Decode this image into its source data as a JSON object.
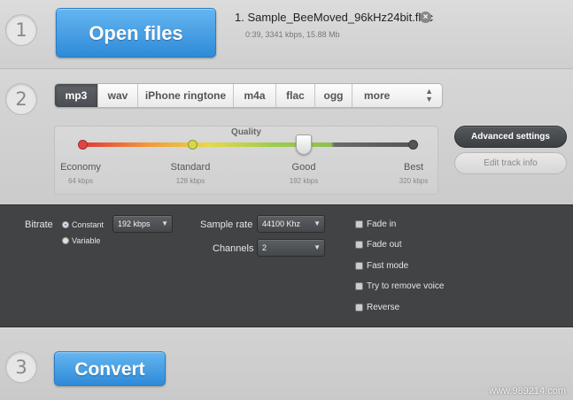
{
  "step1": {
    "number": "1",
    "open_label": "Open files",
    "file_name": "1. Sample_BeeMoved_96kHz24bit.flac",
    "file_meta": "0:39, 3341 kbps, 15.88 Mb",
    "remove_icon": "close-circle-icon"
  },
  "step2": {
    "number": "2",
    "tabs": [
      {
        "label": "mp3",
        "active": true
      },
      {
        "label": "wav",
        "active": false
      },
      {
        "label": "iPhone ringtone",
        "active": false
      },
      {
        "label": "m4a",
        "active": false
      },
      {
        "label": "flac",
        "active": false
      },
      {
        "label": "ogg",
        "active": false
      },
      {
        "label": "more",
        "active": false
      }
    ],
    "quality": {
      "title": "Quality",
      "levels": [
        {
          "name": "Economy",
          "kbps": "64 kbps",
          "color": "#e24444"
        },
        {
          "name": "Standard",
          "kbps": "128 kbps",
          "color": "#d4d84a"
        },
        {
          "name": "Good",
          "kbps": "192 kbps",
          "color": "#9ccc4e"
        },
        {
          "name": "Best",
          "kbps": "320 kbps",
          "color": "#555555"
        }
      ],
      "selected": "Good"
    },
    "advanced_settings_label": "Advanced settings",
    "edit_track_label": "Edit track info"
  },
  "advanced": {
    "bitrate_label": "Bitrate",
    "constant_label": "Constant",
    "variable_label": "Variable",
    "bitrate_mode": "Constant",
    "bitrate_value": "192 kbps",
    "sample_rate_label": "Sample rate",
    "sample_rate_value": "44100 Khz",
    "channels_label": "Channels",
    "channels_value": "2",
    "options": [
      {
        "label": "Fade in",
        "checked": false
      },
      {
        "label": "Fade out",
        "checked": false
      },
      {
        "label": "Fast mode",
        "checked": false
      },
      {
        "label": "Try to remove voice",
        "checked": false
      },
      {
        "label": "Reverse",
        "checked": false
      }
    ]
  },
  "step3": {
    "number": "3",
    "convert_label": "Convert"
  },
  "watermark": "www.989214.com",
  "colors": {
    "accent": "#2f8ad8",
    "dark_panel": "#414345"
  }
}
